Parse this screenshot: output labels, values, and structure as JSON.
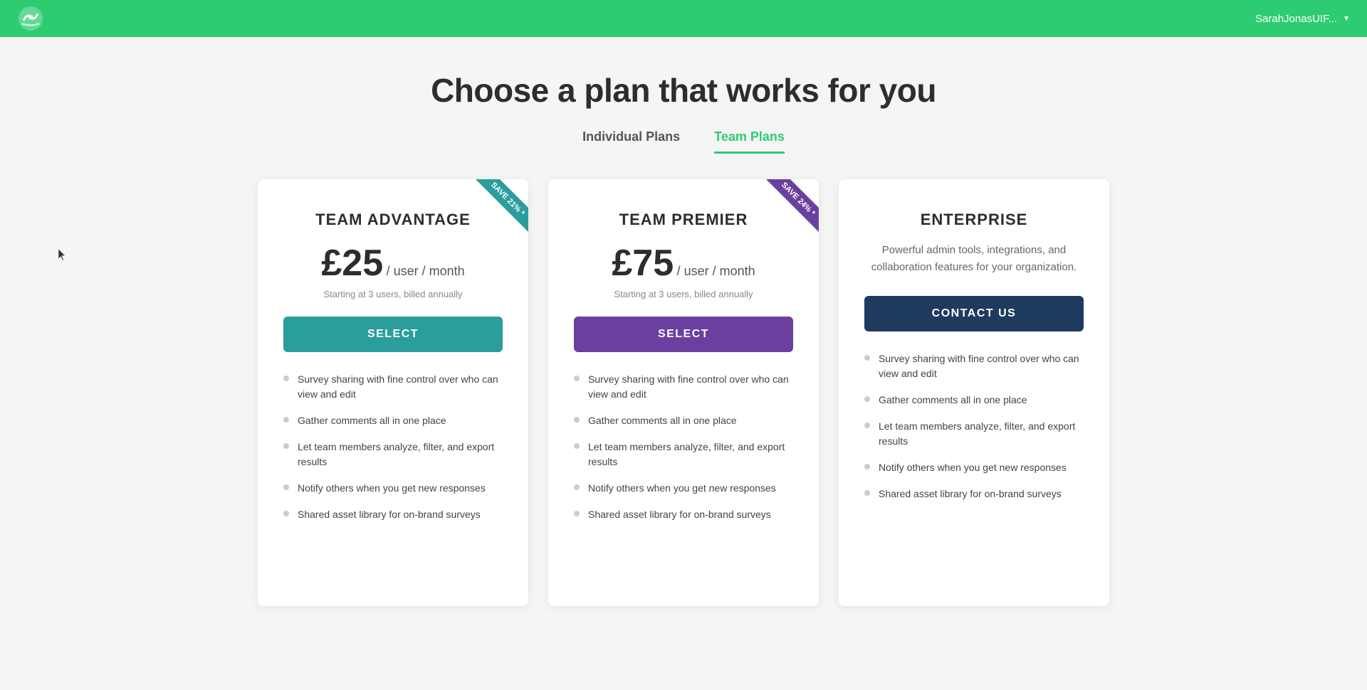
{
  "header": {
    "user_label": "SarahJonasUIF...",
    "logo_alt": "SurveyMonkey logo"
  },
  "page": {
    "title": "Choose a plan that works for you"
  },
  "tabs": [
    {
      "id": "individual",
      "label": "Individual Plans",
      "active": false
    },
    {
      "id": "team",
      "label": "Team Plans",
      "active": true
    }
  ],
  "plans": [
    {
      "id": "team-advantage",
      "name": "TEAM ADVANTAGE",
      "ribbon": true,
      "ribbon_text": "SAVE 21% *",
      "ribbon_color": "teal",
      "price": "£25",
      "price_period": "/ user / month",
      "billing_note": "Starting at 3 users, billed annually",
      "btn_label": "SELECT",
      "btn_color": "teal",
      "enterprise_desc": null,
      "features": [
        "Survey sharing with fine control over who can view and edit",
        "Gather comments all in one place",
        "Let team members analyze, filter, and export results",
        "Notify others when you get new responses",
        "Shared asset library for on-brand surveys"
      ]
    },
    {
      "id": "team-premier",
      "name": "TEAM PREMIER",
      "ribbon": true,
      "ribbon_text": "SAVE 24% *",
      "ribbon_color": "purple",
      "price": "£75",
      "price_period": "/ user / month",
      "billing_note": "Starting at 3 users, billed annually",
      "btn_label": "SELECT",
      "btn_color": "purple",
      "enterprise_desc": null,
      "features": [
        "Survey sharing with fine control over who can view and edit",
        "Gather comments all in one place",
        "Let team members analyze, filter, and export results",
        "Notify others when you get new responses",
        "Shared asset library for on-brand surveys"
      ]
    },
    {
      "id": "enterprise",
      "name": "ENTERPRISE",
      "ribbon": false,
      "ribbon_text": null,
      "ribbon_color": null,
      "price": null,
      "price_period": null,
      "billing_note": null,
      "btn_label": "CONTACT US",
      "btn_color": "navy",
      "enterprise_desc": "Powerful admin tools, integrations, and collaboration features for your organization.",
      "features": [
        "Survey sharing with fine control over who can view and edit",
        "Gather comments all in one place",
        "Let team members analyze, filter, and export results",
        "Notify others when you get new responses",
        "Shared asset library for on-brand surveys"
      ]
    }
  ],
  "colors": {
    "header_bg": "#2ecc71",
    "teal": "#2a9d9d",
    "purple": "#6b3fa0",
    "navy": "#1e3a5f",
    "active_tab": "#2ecc71"
  }
}
